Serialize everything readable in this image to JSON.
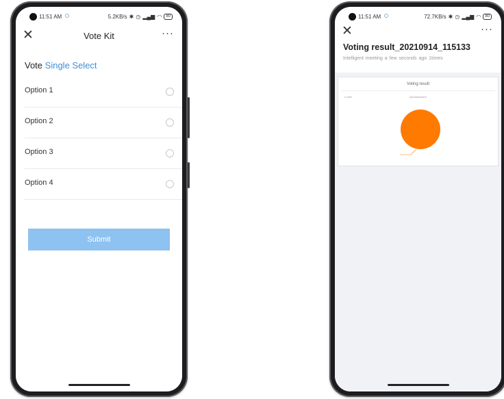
{
  "vote_screen": {
    "status": {
      "time": "11:51 AM",
      "net_speed": "5.2KB/s",
      "battery": "80"
    },
    "nav": {
      "title": "Vote Kit",
      "close_glyph": "✕",
      "more_glyph": "···"
    },
    "vote_label": "Vote",
    "vote_type": "Single Select",
    "options": [
      {
        "label": "Option 1"
      },
      {
        "label": "Option 2"
      },
      {
        "label": "Option 3"
      },
      {
        "label": "Option 4"
      }
    ],
    "submit_label": "Submit"
  },
  "result_screen": {
    "status": {
      "time": "11:51 AM",
      "net_speed": "72.7KB/s",
      "battery": "80"
    },
    "nav": {
      "close_glyph": "✕",
      "more_glyph": "···"
    },
    "title": "Voting result_20210914_115133",
    "meta": {
      "source": "Intelligent meeting",
      "time_ago": "a few seconds ago",
      "count": "1times"
    },
    "card": {
      "title": "Voting result",
      "voter_label": "1 voter",
      "question_label": "Questionnaire"
    },
    "chart_data": {
      "type": "pie",
      "categories": [
        "Option"
      ],
      "values": [
        1
      ],
      "colors": [
        "#ff7a00"
      ]
    }
  }
}
